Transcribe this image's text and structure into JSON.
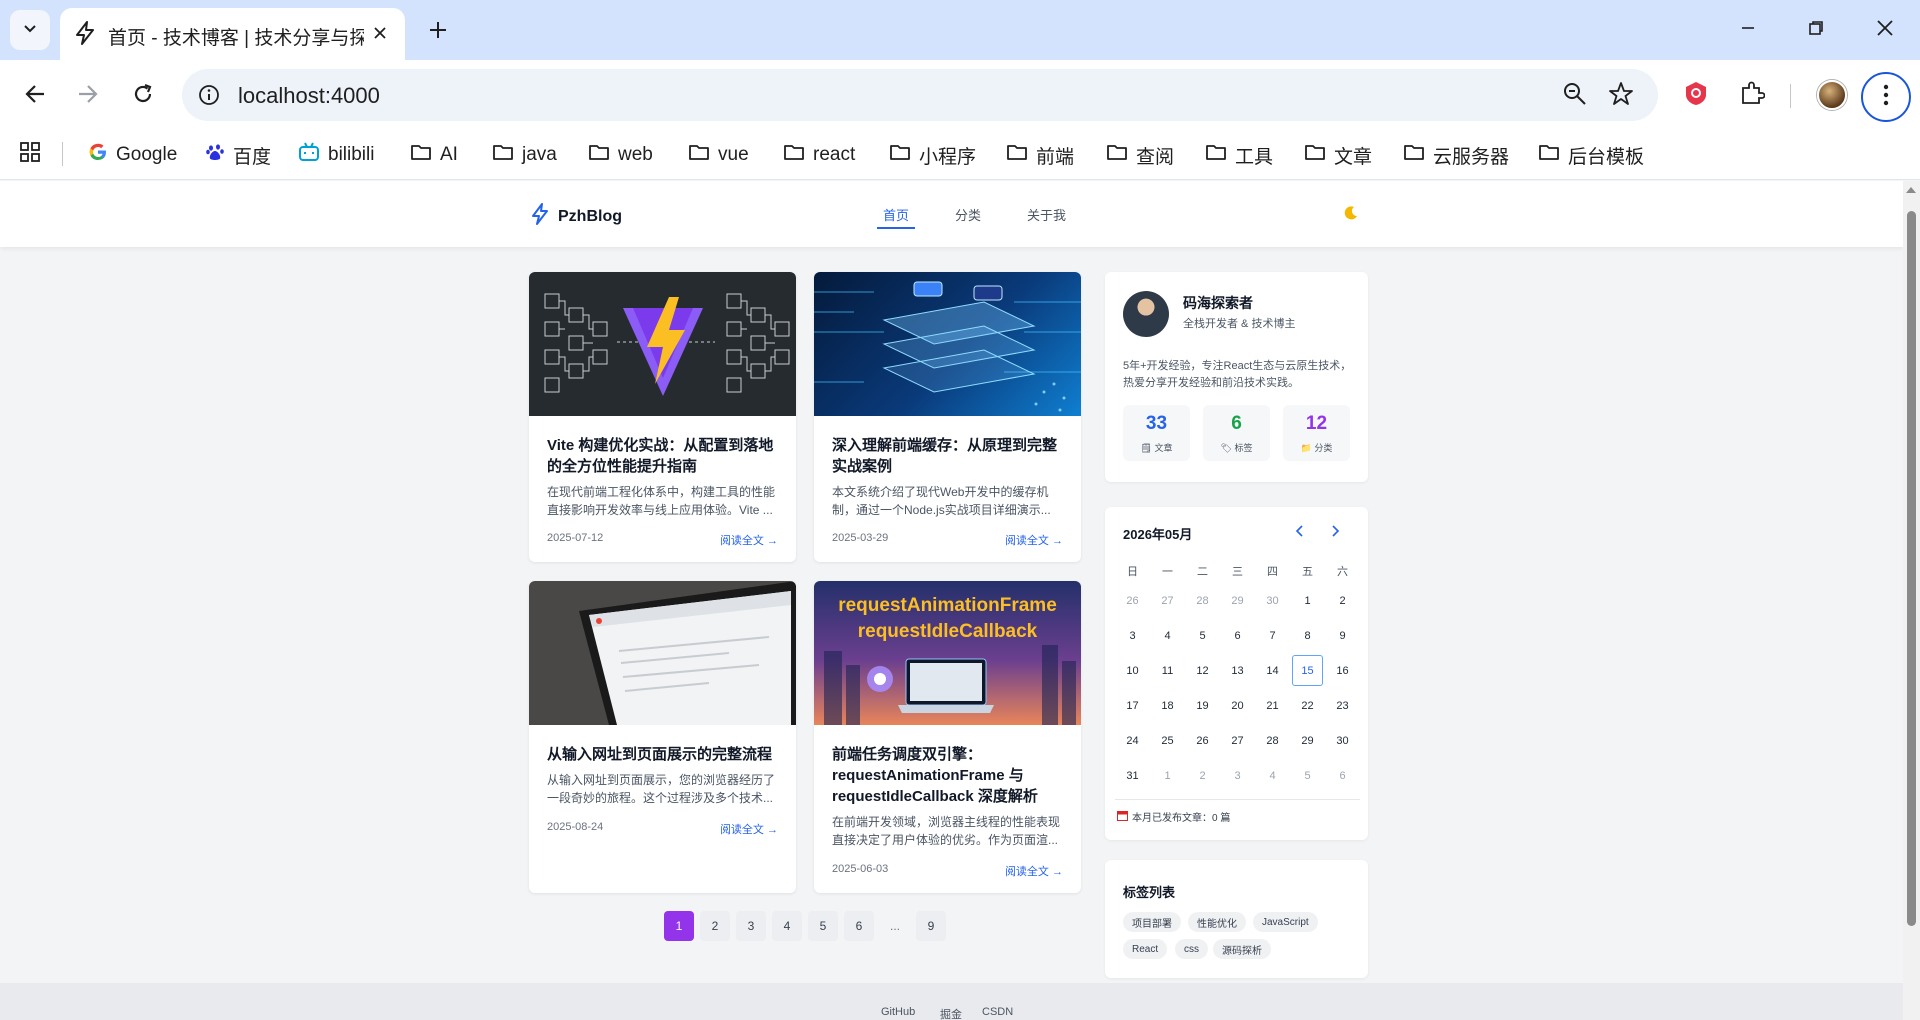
{
  "browser": {
    "tab_title": "首页 - 技术博客 | 技术分享与探",
    "url": "localhost:4000",
    "bookmarks": [
      {
        "label": "Google",
        "icon": "google-icon"
      },
      {
        "label": "百度",
        "icon": "baidu-icon"
      },
      {
        "label": "bilibili",
        "icon": "bilibili-icon"
      },
      {
        "label": "AI",
        "icon": "folder-icon"
      },
      {
        "label": "java",
        "icon": "folder-icon"
      },
      {
        "label": "web",
        "icon": "folder-icon"
      },
      {
        "label": "vue",
        "icon": "folder-icon"
      },
      {
        "label": "react",
        "icon": "folder-icon"
      },
      {
        "label": "小程序",
        "icon": "folder-icon"
      },
      {
        "label": "前端",
        "icon": "folder-icon"
      },
      {
        "label": "查阅",
        "icon": "folder-icon"
      },
      {
        "label": "工具",
        "icon": "folder-icon"
      },
      {
        "label": "文章",
        "icon": "folder-icon"
      },
      {
        "label": "云服务器",
        "icon": "folder-icon"
      },
      {
        "label": "后台模板",
        "icon": "folder-icon"
      }
    ]
  },
  "site": {
    "brand": "PzhBlog",
    "nav": [
      "首页",
      "分类",
      "关于我"
    ],
    "theme_icon": "moon-icon"
  },
  "posts": [
    {
      "title": "Vite 构建优化实战：从配置到落地的全方位性能提升指南",
      "excerpt": "在现代前端工程化体系中，构建工具的性能直接影响开发效率与线上应用体验。Vite ...",
      "date": "2025-07-12",
      "more": "阅读全文 →"
    },
    {
      "title": "深入理解前端缓存：从原理到完整实战案例",
      "excerpt": "本文系统介绍了现代Web开发中的缓存机制，通过一个Node.js实战项目详细演示...",
      "date": "2025-03-29",
      "more": "阅读全文 →"
    },
    {
      "title": "从输入网址到页面展示的完整流程",
      "excerpt": "从输入网址到页面展示，您的浏览器经历了一段奇妙的旅程。这个过程涉及多个技术...",
      "date": "2025-08-24",
      "more": "阅读全文 →"
    },
    {
      "title": "前端任务调度双引擎：requestAnimationFrame 与 requestIdleCallback 深度解析",
      "excerpt": "在前端开发领域，浏览器主线程的性能表现直接决定了用户体验的优劣。作为页面渲...",
      "date": "2025-06-03",
      "more": "阅读全文 →",
      "thumb_text": [
        "requestAnimationFrame",
        "requestIdleCallback"
      ]
    }
  ],
  "pagination": {
    "pages": [
      "1",
      "2",
      "3",
      "4",
      "5",
      "6",
      "...",
      "9"
    ],
    "current": "1"
  },
  "profile": {
    "name": "码海探索者",
    "role": "全栈开发者 & 技术博主",
    "bio": "5年+开发经验，专注React生态与云原生技术，热爱分享开发经验和前沿技术实践。",
    "stats": [
      {
        "value": "33",
        "label": "文章",
        "color": "#2563eb",
        "icon": "document-icon"
      },
      {
        "value": "6",
        "label": "标签",
        "color": "#16a34a",
        "icon": "tag-icon"
      },
      {
        "value": "12",
        "label": "分类",
        "color": "#9333ea",
        "icon": "folder-icon"
      }
    ]
  },
  "calendar": {
    "title": "2026年05月",
    "weekdays": [
      "日",
      "一",
      "二",
      "三",
      "四",
      "五",
      "六"
    ],
    "days": [
      {
        "d": "26",
        "muted": true
      },
      {
        "d": "27",
        "muted": true
      },
      {
        "d": "28",
        "muted": true
      },
      {
        "d": "29",
        "muted": true
      },
      {
        "d": "30",
        "muted": true
      },
      {
        "d": "1"
      },
      {
        "d": "2"
      },
      {
        "d": "3"
      },
      {
        "d": "4"
      },
      {
        "d": "5"
      },
      {
        "d": "6"
      },
      {
        "d": "7"
      },
      {
        "d": "8"
      },
      {
        "d": "9"
      },
      {
        "d": "10"
      },
      {
        "d": "11"
      },
      {
        "d": "12"
      },
      {
        "d": "13"
      },
      {
        "d": "14"
      },
      {
        "d": "15",
        "today": true
      },
      {
        "d": "16"
      },
      {
        "d": "17"
      },
      {
        "d": "18"
      },
      {
        "d": "19"
      },
      {
        "d": "20"
      },
      {
        "d": "21"
      },
      {
        "d": "22"
      },
      {
        "d": "23"
      },
      {
        "d": "24"
      },
      {
        "d": "25"
      },
      {
        "d": "26"
      },
      {
        "d": "27"
      },
      {
        "d": "28"
      },
      {
        "d": "29"
      },
      {
        "d": "30"
      },
      {
        "d": "31"
      },
      {
        "d": "1",
        "muted": true
      },
      {
        "d": "2",
        "muted": true
      },
      {
        "d": "3",
        "muted": true
      },
      {
        "d": "4",
        "muted": true
      },
      {
        "d": "5",
        "muted": true
      },
      {
        "d": "6",
        "muted": true
      }
    ],
    "footer": "本月已发布文章：0 篇"
  },
  "tags": {
    "title": "标签列表",
    "items": [
      "项目部署",
      "性能优化",
      "JavaScript",
      "React",
      "css",
      "源码探析"
    ]
  },
  "footer": {
    "links": [
      "GitHub",
      "掘金",
      "CSDN"
    ]
  }
}
